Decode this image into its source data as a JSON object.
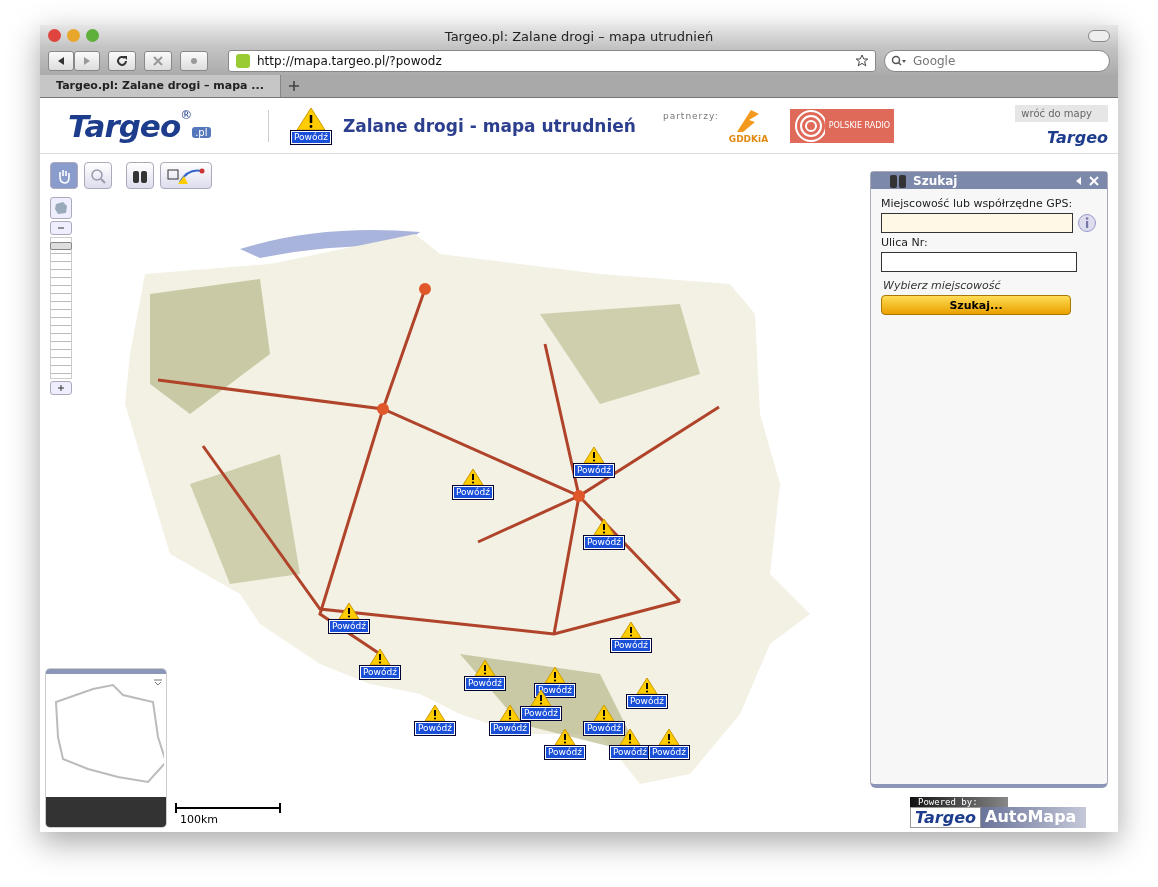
{
  "window": {
    "title": "Targeo.pl: Zalane drogi – mapa utrudnień"
  },
  "toolbar": {
    "url": "http://mapa.targeo.pl/?powodz",
    "search_placeholder": "Google"
  },
  "tabs": [
    {
      "label": "Targeo.pl: Zalane drogi – mapa ...",
      "selected": true
    }
  ],
  "header": {
    "logo": "Targeo",
    "logo_mark": "®",
    "logo_suffix": ".pl",
    "badge": "Powódź",
    "title": "Zalane drogi - mapa utrudnień",
    "partners_label": "partnerzy:",
    "partners": [
      {
        "kind": "gddkia",
        "name": "GDDKiA"
      },
      {
        "kind": "radio",
        "name": "POLSKIE RADIO"
      }
    ],
    "back_link": "wróć do mapy",
    "small_logo": "Targeo"
  },
  "markers": [
    {
      "label": "Powódź"
    },
    {
      "label": "Powódź"
    },
    {
      "label": "Powódź"
    },
    {
      "label": "Powódź"
    },
    {
      "label": "Powódź"
    },
    {
      "label": "Powódź"
    },
    {
      "label": "Powódź"
    },
    {
      "label": "Powódź"
    },
    {
      "label": "Powódź"
    },
    {
      "label": "Powódź"
    },
    {
      "label": "Powódź"
    },
    {
      "label": "Powódź"
    },
    {
      "label": "Powódź"
    },
    {
      "label": "Powódź"
    },
    {
      "label": "Powódź"
    },
    {
      "label": "Powódź"
    }
  ],
  "search_panel": {
    "title": "Szukaj",
    "city_label": "Miejscowość lub współrzędne GPS:",
    "street_label": "Ulica Nr:",
    "hint": "Wybierz miejscowość",
    "button": "Szukaj..."
  },
  "zoom": {
    "level": 0.97
  },
  "scale": "100km",
  "footer": {
    "powered": "Powered by:",
    "brand1": "Targeo",
    "brand2": "AutoMapa"
  }
}
